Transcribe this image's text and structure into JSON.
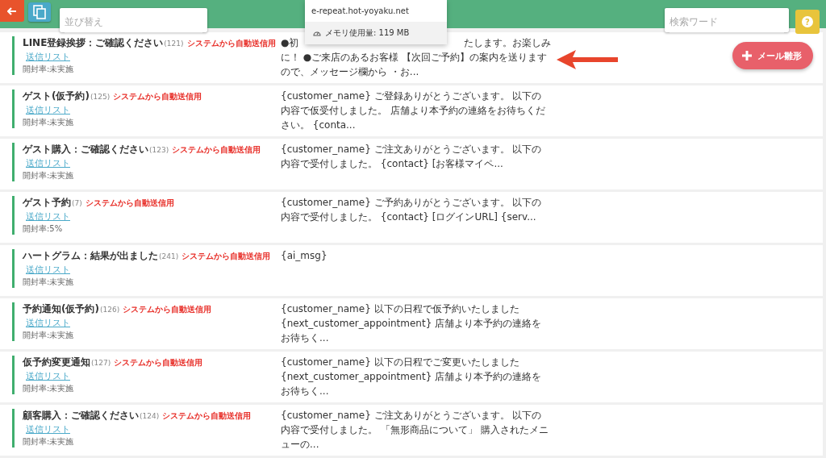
{
  "toolbar": {
    "sort": {
      "placeholder": "並び替え"
    },
    "search": {
      "placeholder": "検索ワード"
    },
    "help_label": "?",
    "add_button": "メール雛形"
  },
  "popup": {
    "url": "e-repeat.hot-yoyaku.net",
    "memory": "メモリ使用量: 119 MB"
  },
  "templates": [
    {
      "title": "LINE登録挨拶：ご確認ください",
      "count": "(121)",
      "tag": "システムから自動送信用",
      "link": "送信リスト",
      "open_rate": "開封率:未実施",
      "message_start": "●初",
      "message_first_end": "たします。お楽しみ",
      "message": "に！ ●ご来店のあるお客様 【次回ご予約】の案内を送りますので、メッセージ欄から ・お..."
    },
    {
      "title": "ゲスト(仮予約)",
      "count": "(125)",
      "tag": "システムから自動送信用",
      "link": "送信リスト",
      "open_rate": "開封率:未実施",
      "message": "{customer_name} ご登録ありがとうございます。 以下の内容で仮受付しました。 店舗より本予約の連絡をお待ちください。 {conta..."
    },
    {
      "title": "ゲスト購入：ご確認ください",
      "count": "(123)",
      "tag": "システムから自動送信用",
      "link": "送信リスト",
      "open_rate": "開封率:未実施",
      "message": "{customer_name} ご注文ありがとうございます。 以下の内容で受付しました。 {contact} [お客様マイペ..."
    },
    {
      "title": "ゲスト予約",
      "count": "(7)",
      "tag": "システムから自動送信用",
      "link": "送信リスト",
      "open_rate": "開封率:5%",
      "message": "{customer_name} ご予約ありがとうございます。 以下の内容で受付しました。 {contact} [ログインURL] {serv..."
    },
    {
      "title": "ハートグラム：結果が出ました",
      "count": "(241)",
      "tag": "システムから自動送信用",
      "link": "送信リスト",
      "open_rate": "開封率:未実施",
      "message": "{ai_msg}"
    },
    {
      "title": "予約通知(仮予約)",
      "count": "(126)",
      "tag": "システムから自動送信用",
      "link": "送信リスト",
      "open_rate": "開封率:未実施",
      "message": "{customer_name} 以下の日程で仮予約いたしました {next_customer_appointment} 店舗より本予約の連絡をお待ちく..."
    },
    {
      "title": "仮予約変更通知",
      "count": "(127)",
      "tag": "システムから自動送信用",
      "link": "送信リスト",
      "open_rate": "開封率:未実施",
      "message": "{customer_name} 以下の日程でご変更いたしました {next_customer_appointment} 店舗より本予約の連絡をお待ちく..."
    },
    {
      "title": "顧客購入：ご確認ください",
      "count": "(124)",
      "tag": "システムから自動送信用",
      "link": "送信リスト",
      "open_rate": "開封率:未実施",
      "message": "{customer_name} ご注文ありがとうございます。 以下の内容で受付しました。 「無形商品について」 購入されたメニューの..."
    }
  ]
}
